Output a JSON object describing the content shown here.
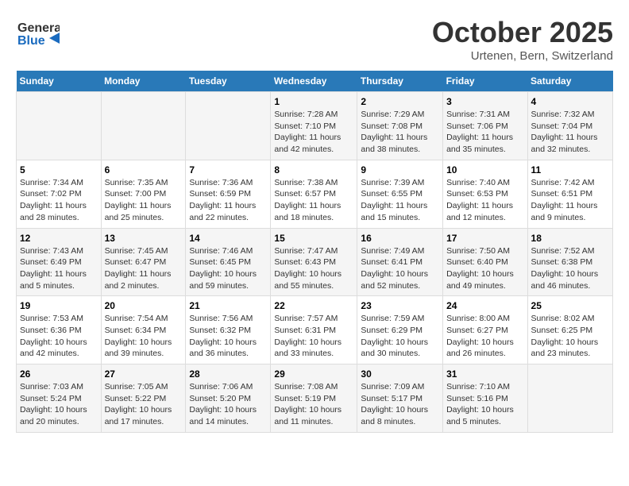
{
  "header": {
    "logo_general": "General",
    "logo_blue": "Blue",
    "month_title": "October 2025",
    "location": "Urtenen, Bern, Switzerland"
  },
  "weekdays": [
    "Sunday",
    "Monday",
    "Tuesday",
    "Wednesday",
    "Thursday",
    "Friday",
    "Saturday"
  ],
  "weeks": [
    [
      {
        "day": "",
        "info": ""
      },
      {
        "day": "",
        "info": ""
      },
      {
        "day": "",
        "info": ""
      },
      {
        "day": "1",
        "info": "Sunrise: 7:28 AM\nSunset: 7:10 PM\nDaylight: 11 hours\nand 42 minutes."
      },
      {
        "day": "2",
        "info": "Sunrise: 7:29 AM\nSunset: 7:08 PM\nDaylight: 11 hours\nand 38 minutes."
      },
      {
        "day": "3",
        "info": "Sunrise: 7:31 AM\nSunset: 7:06 PM\nDaylight: 11 hours\nand 35 minutes."
      },
      {
        "day": "4",
        "info": "Sunrise: 7:32 AM\nSunset: 7:04 PM\nDaylight: 11 hours\nand 32 minutes."
      }
    ],
    [
      {
        "day": "5",
        "info": "Sunrise: 7:34 AM\nSunset: 7:02 PM\nDaylight: 11 hours\nand 28 minutes."
      },
      {
        "day": "6",
        "info": "Sunrise: 7:35 AM\nSunset: 7:00 PM\nDaylight: 11 hours\nand 25 minutes."
      },
      {
        "day": "7",
        "info": "Sunrise: 7:36 AM\nSunset: 6:59 PM\nDaylight: 11 hours\nand 22 minutes."
      },
      {
        "day": "8",
        "info": "Sunrise: 7:38 AM\nSunset: 6:57 PM\nDaylight: 11 hours\nand 18 minutes."
      },
      {
        "day": "9",
        "info": "Sunrise: 7:39 AM\nSunset: 6:55 PM\nDaylight: 11 hours\nand 15 minutes."
      },
      {
        "day": "10",
        "info": "Sunrise: 7:40 AM\nSunset: 6:53 PM\nDaylight: 11 hours\nand 12 minutes."
      },
      {
        "day": "11",
        "info": "Sunrise: 7:42 AM\nSunset: 6:51 PM\nDaylight: 11 hours\nand 9 minutes."
      }
    ],
    [
      {
        "day": "12",
        "info": "Sunrise: 7:43 AM\nSunset: 6:49 PM\nDaylight: 11 hours\nand 5 minutes."
      },
      {
        "day": "13",
        "info": "Sunrise: 7:45 AM\nSunset: 6:47 PM\nDaylight: 11 hours\nand 2 minutes."
      },
      {
        "day": "14",
        "info": "Sunrise: 7:46 AM\nSunset: 6:45 PM\nDaylight: 10 hours\nand 59 minutes."
      },
      {
        "day": "15",
        "info": "Sunrise: 7:47 AM\nSunset: 6:43 PM\nDaylight: 10 hours\nand 55 minutes."
      },
      {
        "day": "16",
        "info": "Sunrise: 7:49 AM\nSunset: 6:41 PM\nDaylight: 10 hours\nand 52 minutes."
      },
      {
        "day": "17",
        "info": "Sunrise: 7:50 AM\nSunset: 6:40 PM\nDaylight: 10 hours\nand 49 minutes."
      },
      {
        "day": "18",
        "info": "Sunrise: 7:52 AM\nSunset: 6:38 PM\nDaylight: 10 hours\nand 46 minutes."
      }
    ],
    [
      {
        "day": "19",
        "info": "Sunrise: 7:53 AM\nSunset: 6:36 PM\nDaylight: 10 hours\nand 42 minutes."
      },
      {
        "day": "20",
        "info": "Sunrise: 7:54 AM\nSunset: 6:34 PM\nDaylight: 10 hours\nand 39 minutes."
      },
      {
        "day": "21",
        "info": "Sunrise: 7:56 AM\nSunset: 6:32 PM\nDaylight: 10 hours\nand 36 minutes."
      },
      {
        "day": "22",
        "info": "Sunrise: 7:57 AM\nSunset: 6:31 PM\nDaylight: 10 hours\nand 33 minutes."
      },
      {
        "day": "23",
        "info": "Sunrise: 7:59 AM\nSunset: 6:29 PM\nDaylight: 10 hours\nand 30 minutes."
      },
      {
        "day": "24",
        "info": "Sunrise: 8:00 AM\nSunset: 6:27 PM\nDaylight: 10 hours\nand 26 minutes."
      },
      {
        "day": "25",
        "info": "Sunrise: 8:02 AM\nSunset: 6:25 PM\nDaylight: 10 hours\nand 23 minutes."
      }
    ],
    [
      {
        "day": "26",
        "info": "Sunrise: 7:03 AM\nSunset: 5:24 PM\nDaylight: 10 hours\nand 20 minutes."
      },
      {
        "day": "27",
        "info": "Sunrise: 7:05 AM\nSunset: 5:22 PM\nDaylight: 10 hours\nand 17 minutes."
      },
      {
        "day": "28",
        "info": "Sunrise: 7:06 AM\nSunset: 5:20 PM\nDaylight: 10 hours\nand 14 minutes."
      },
      {
        "day": "29",
        "info": "Sunrise: 7:08 AM\nSunset: 5:19 PM\nDaylight: 10 hours\nand 11 minutes."
      },
      {
        "day": "30",
        "info": "Sunrise: 7:09 AM\nSunset: 5:17 PM\nDaylight: 10 hours\nand 8 minutes."
      },
      {
        "day": "31",
        "info": "Sunrise: 7:10 AM\nSunset: 5:16 PM\nDaylight: 10 hours\nand 5 minutes."
      },
      {
        "day": "",
        "info": ""
      }
    ]
  ]
}
